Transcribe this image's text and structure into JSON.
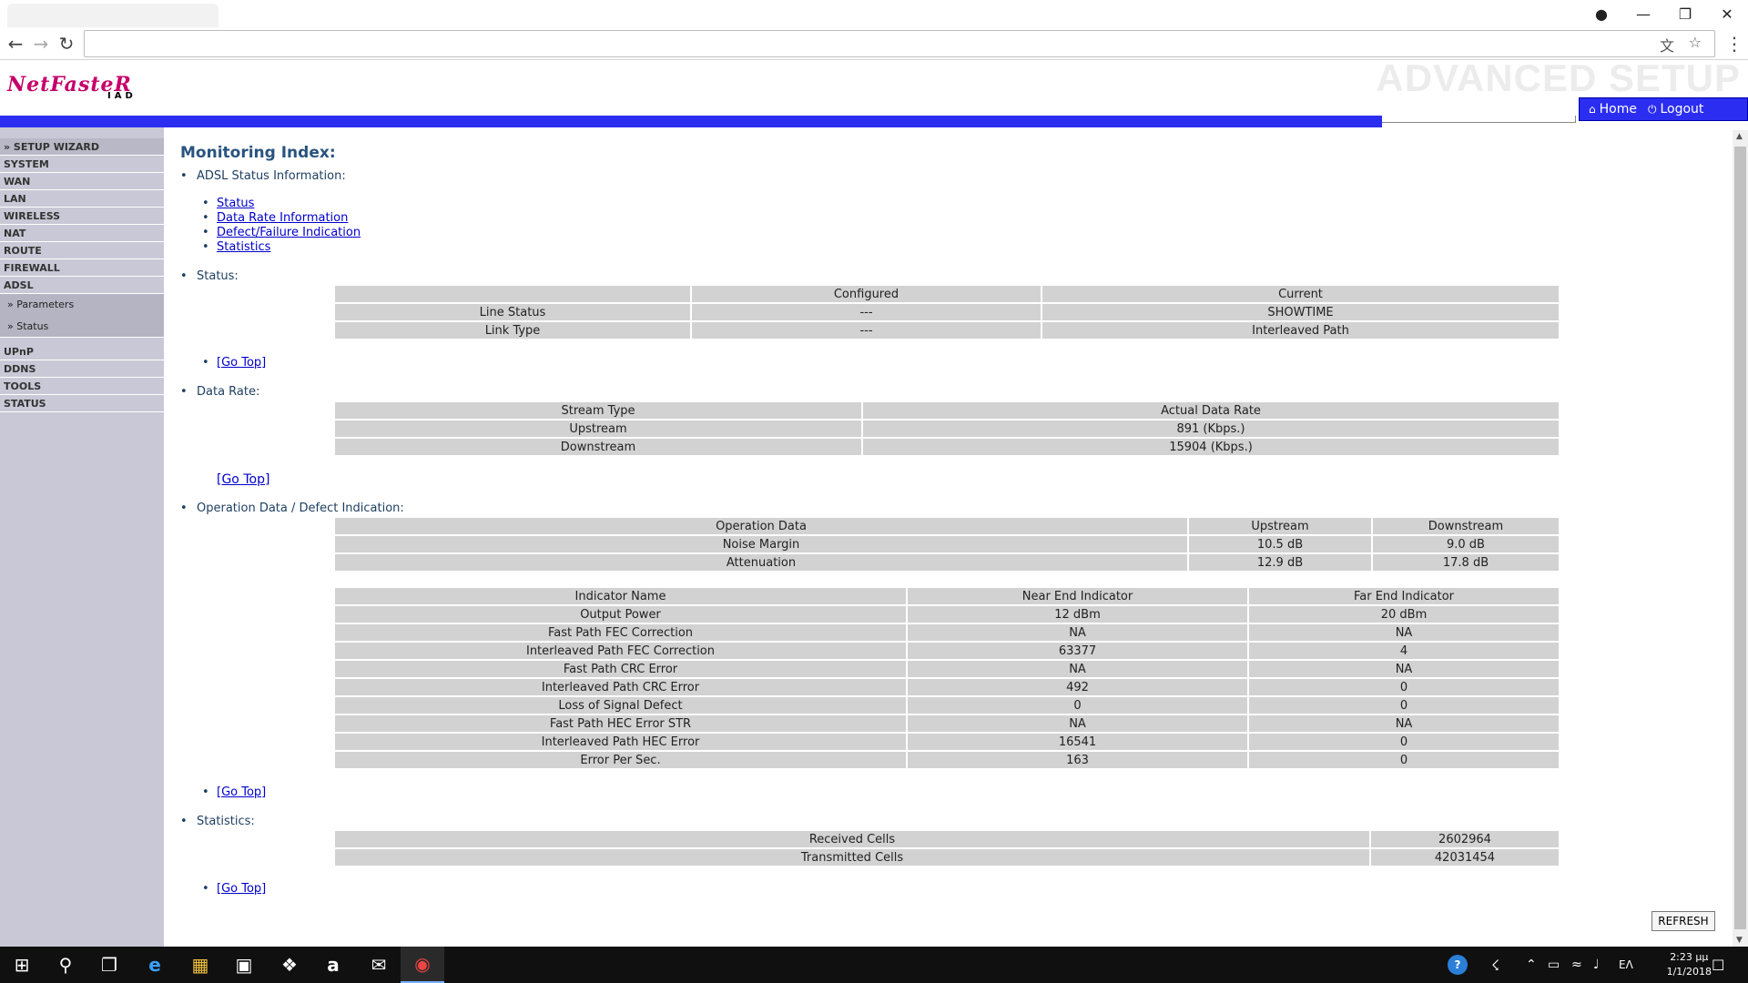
{
  "browser": {
    "icons": {
      "back": "arrow-left-icon",
      "forward": "arrow-right-icon",
      "reload": "reload-icon",
      "translate": "translate-icon",
      "star": "star-icon",
      "menu": "kebab-menu-icon",
      "account": "account-icon"
    }
  },
  "header": {
    "logo_main": "NetFasteR",
    "logo_sub": "IAD",
    "banner": "ADVANCED SETUP",
    "home_label": "Home",
    "logout_label": "Logout",
    "accent_color": "#2b2ef0",
    "logo_color": "#c4006a"
  },
  "sidebar": {
    "items": [
      {
        "label": "» SETUP WIZARD"
      },
      {
        "label": "SYSTEM"
      },
      {
        "label": "WAN"
      },
      {
        "label": "LAN"
      },
      {
        "label": "WIRELESS"
      },
      {
        "label": "NAT"
      },
      {
        "label": "ROUTE"
      },
      {
        "label": "FIREWALL"
      },
      {
        "label": "ADSL"
      },
      {
        "label": "UPnP"
      },
      {
        "label": "DDNS"
      },
      {
        "label": "TOOLS"
      },
      {
        "label": "STATUS"
      }
    ],
    "adsl_sub": [
      {
        "label": "» Parameters"
      },
      {
        "label": "» Status"
      }
    ]
  },
  "main": {
    "title": "Monitoring Index:",
    "index_heading": "ADSL Status Information:",
    "index_links": [
      "Status",
      "Data Rate Information",
      "Defect/Failure Indication",
      "Statistics"
    ],
    "go_top": "[Go Top]",
    "status": {
      "heading": "Status:",
      "header": [
        "",
        "Configured",
        "Current"
      ],
      "rows": [
        [
          "Line Status",
          "---",
          "SHOWTIME"
        ],
        [
          "Link Type",
          "---",
          "Interleaved Path"
        ]
      ]
    },
    "data_rate": {
      "heading": "Data Rate:",
      "header": [
        "Stream Type",
        "Actual Data Rate"
      ],
      "rows": [
        [
          "Upstream",
          "891 (Kbps.)"
        ],
        [
          "Downstream",
          "15904 (Kbps.)"
        ]
      ]
    },
    "operation": {
      "heading": "Operation Data / Defect Indication:",
      "header": [
        "Operation Data",
        "Upstream",
        "Downstream"
      ],
      "rows": [
        [
          "Noise Margin",
          "10.5 dB",
          "9.0 dB"
        ],
        [
          "Attenuation",
          "12.9 dB",
          "17.8 dB"
        ]
      ]
    },
    "indicators": {
      "header": [
        "Indicator Name",
        "Near End Indicator",
        "Far End Indicator"
      ],
      "rows": [
        [
          "Output Power",
          "12 dBm",
          "20 dBm"
        ],
        [
          "Fast Path FEC Correction",
          "NA",
          "NA"
        ],
        [
          "Interleaved Path FEC Correction",
          "63377",
          "4"
        ],
        [
          "Fast Path CRC Error",
          "NA",
          "NA"
        ],
        [
          "Interleaved Path CRC Error",
          "492",
          "0"
        ],
        [
          "Loss of Signal Defect",
          "0",
          "0"
        ],
        [
          "Fast Path HEC Error STR",
          "NA",
          "NA"
        ],
        [
          "Interleaved Path HEC Error",
          "16541",
          "0"
        ],
        [
          "Error Per Sec.",
          "163",
          "0"
        ]
      ]
    },
    "statistics": {
      "heading": "Statistics:",
      "rows": [
        [
          "Received Cells",
          "2602964"
        ],
        [
          "Transmitted Cells",
          "42031454"
        ]
      ]
    },
    "refresh_label": "REFRESH"
  },
  "taskbar": {
    "clock_time": "2:23 μμ",
    "clock_date": "1/1/2018",
    "lang": "ΕΛ"
  }
}
